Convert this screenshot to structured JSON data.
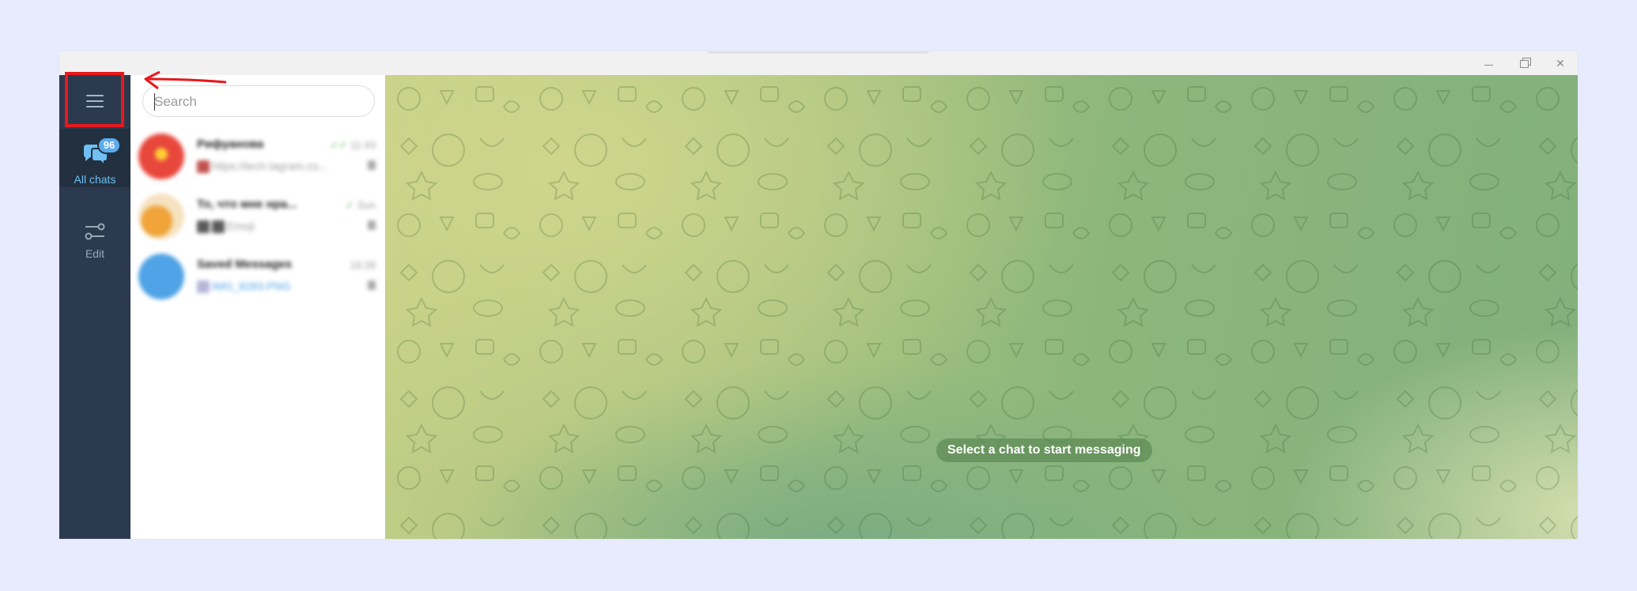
{
  "window": {
    "controls": {
      "minimize_icon": "minimize-icon",
      "maximize_icon": "restore-icon",
      "close_icon": "close-icon",
      "close_glyph": "✕"
    }
  },
  "sidebar": {
    "menu_icon": "hamburger-menu-icon",
    "folders": [
      {
        "label": "All chats",
        "icon": "chats-icon",
        "badge": "96",
        "active": true
      },
      {
        "label": "Edit",
        "icon": "sliders-icon",
        "active": false
      }
    ]
  },
  "search": {
    "placeholder": "Search",
    "value": ""
  },
  "chats": [
    {
      "name": "Рифуанова",
      "time": "11:43",
      "preview": "https://tech.tagram.co...",
      "pinned": true,
      "avatar_color": "#e8473c"
    },
    {
      "name": "То, что мне нра...",
      "time": "Sun",
      "preview": "Emoji",
      "pinned": true,
      "avatar_color": "#e8a23c"
    },
    {
      "name": "Saved Messages",
      "time": "16:28",
      "preview": "IMG_8283.PNG",
      "pinned": true,
      "avatar_color": "#4fa3e6"
    }
  ],
  "main": {
    "empty_state": "Select a chat to start messaging"
  },
  "colors": {
    "rail_bg": "#2b3a4f",
    "accent": "#5dacec",
    "highlight": "#e8191c"
  }
}
